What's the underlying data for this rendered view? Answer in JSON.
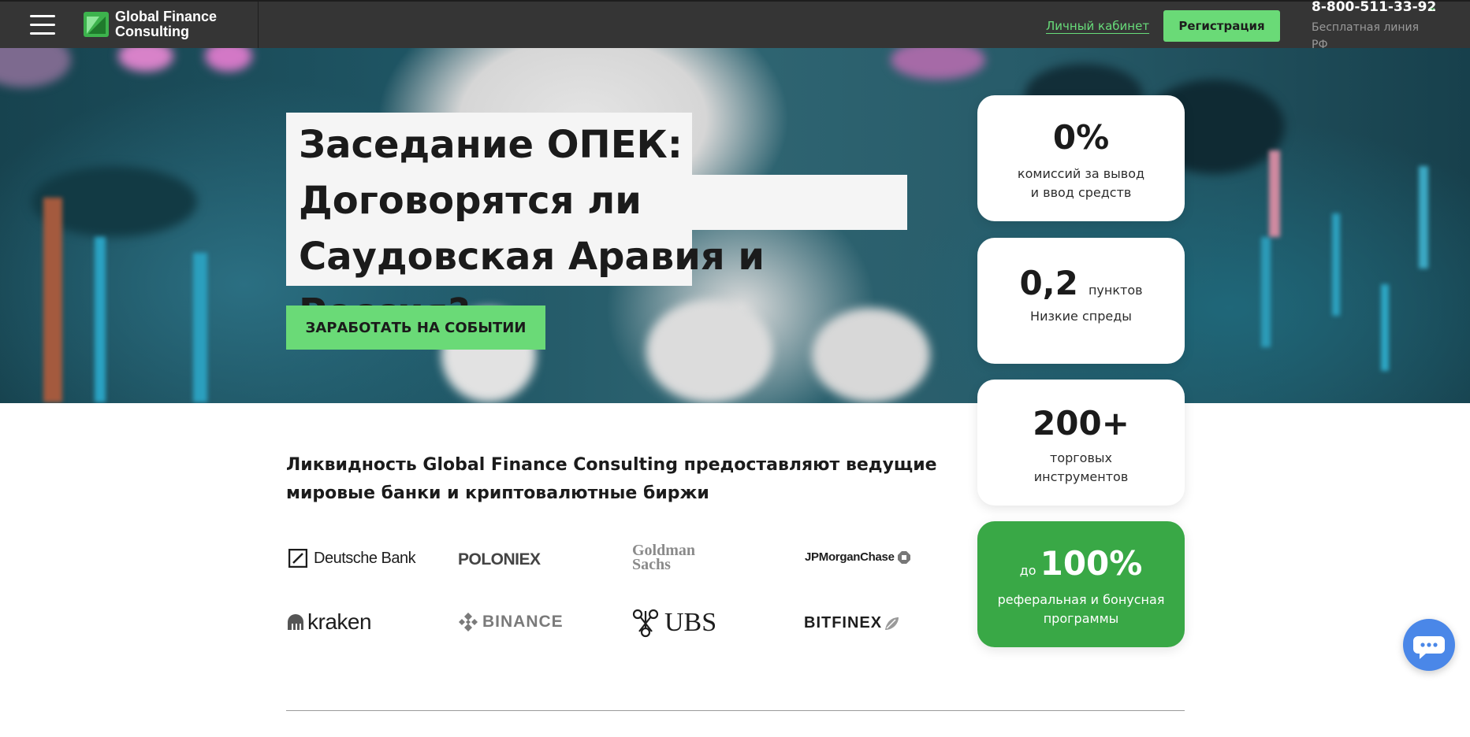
{
  "header": {
    "logo_line1": "Global Finance",
    "logo_line2": "Consulting",
    "cabinet_label": "Личный кабинет",
    "register_label": "Регистрация",
    "phone": "8-800-511-33-92",
    "phone_note": "Бесплатная линия РФ"
  },
  "hero": {
    "title_bold": "Заседание ОПЕК:",
    "title_rest": "Договорятся ли Саудовская Аравия и Россия?",
    "cta_label": "ЗАРАБОТАТЬ НА СОБЫТИИ"
  },
  "stats": [
    {
      "value": "0%",
      "unit": "",
      "caption_line1": "комиссий за вывод",
      "caption_line2": "и ввод средств"
    },
    {
      "value": "0,2",
      "unit": "пунктов",
      "caption_line1": "Низкие спреды",
      "caption_line2": ""
    },
    {
      "value": "200+",
      "unit": "",
      "caption_line1": "торговых",
      "caption_line2": "инструментов"
    },
    {
      "prefix": "до",
      "value": "100%",
      "caption_line1": "реферальная и бонусная",
      "caption_line2": "программы"
    }
  ],
  "partners": {
    "text": "Ликвидность Global Finance Consulting предоставляют ведущие мировые банки и криптовалютные биржи",
    "logos": {
      "deutsche": "Deutsche Bank",
      "poloniex": "POLONIEX",
      "goldman_1": "Goldman",
      "goldman_2": "Sachs",
      "jpmorgan": "JPMorganChase",
      "kraken": "kraken",
      "binance": "BINANCE",
      "ubs": "UBS",
      "bitfinex": "BITFINEX"
    }
  },
  "colors": {
    "header_bg": "#353535",
    "accent_green": "#6ada77",
    "card_green": "#39a846",
    "chat_blue": "#4a87e8"
  }
}
